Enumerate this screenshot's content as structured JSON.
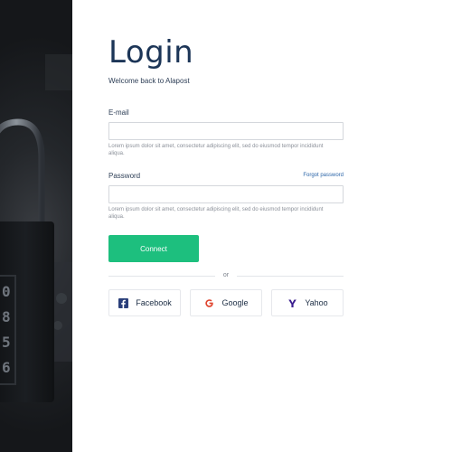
{
  "login": {
    "title": "Login",
    "subtitle": "Welcome back to Alapost",
    "email": {
      "label": "E-mail",
      "value": "",
      "placeholder": "",
      "help": "Lorem ipsum dolor sit amet, consectetur adipiscing elit, sed do eiusmod tempor incididunt aliqua."
    },
    "password": {
      "label": "Password",
      "forgot_label": "Forgot password",
      "value": "",
      "placeholder": "",
      "help": "Lorem ipsum dolor sit amet, consectetur adipiscing elit, sed do eiusmod tempor incididunt aliqua."
    },
    "connect_label": "Connect",
    "divider_text": "or",
    "social": [
      {
        "label": "Facebook",
        "icon": "facebook-icon"
      },
      {
        "label": "Google",
        "icon": "google-icon"
      },
      {
        "label": "Yahoo",
        "icon": "yahoo-icon"
      }
    ]
  },
  "colors": {
    "title": "#1c3557",
    "primary_button": "#1dbf7e",
    "link": "#2a64a8",
    "facebook": "#3b5998",
    "google": "#e0452f",
    "yahoo": "#41169a"
  }
}
